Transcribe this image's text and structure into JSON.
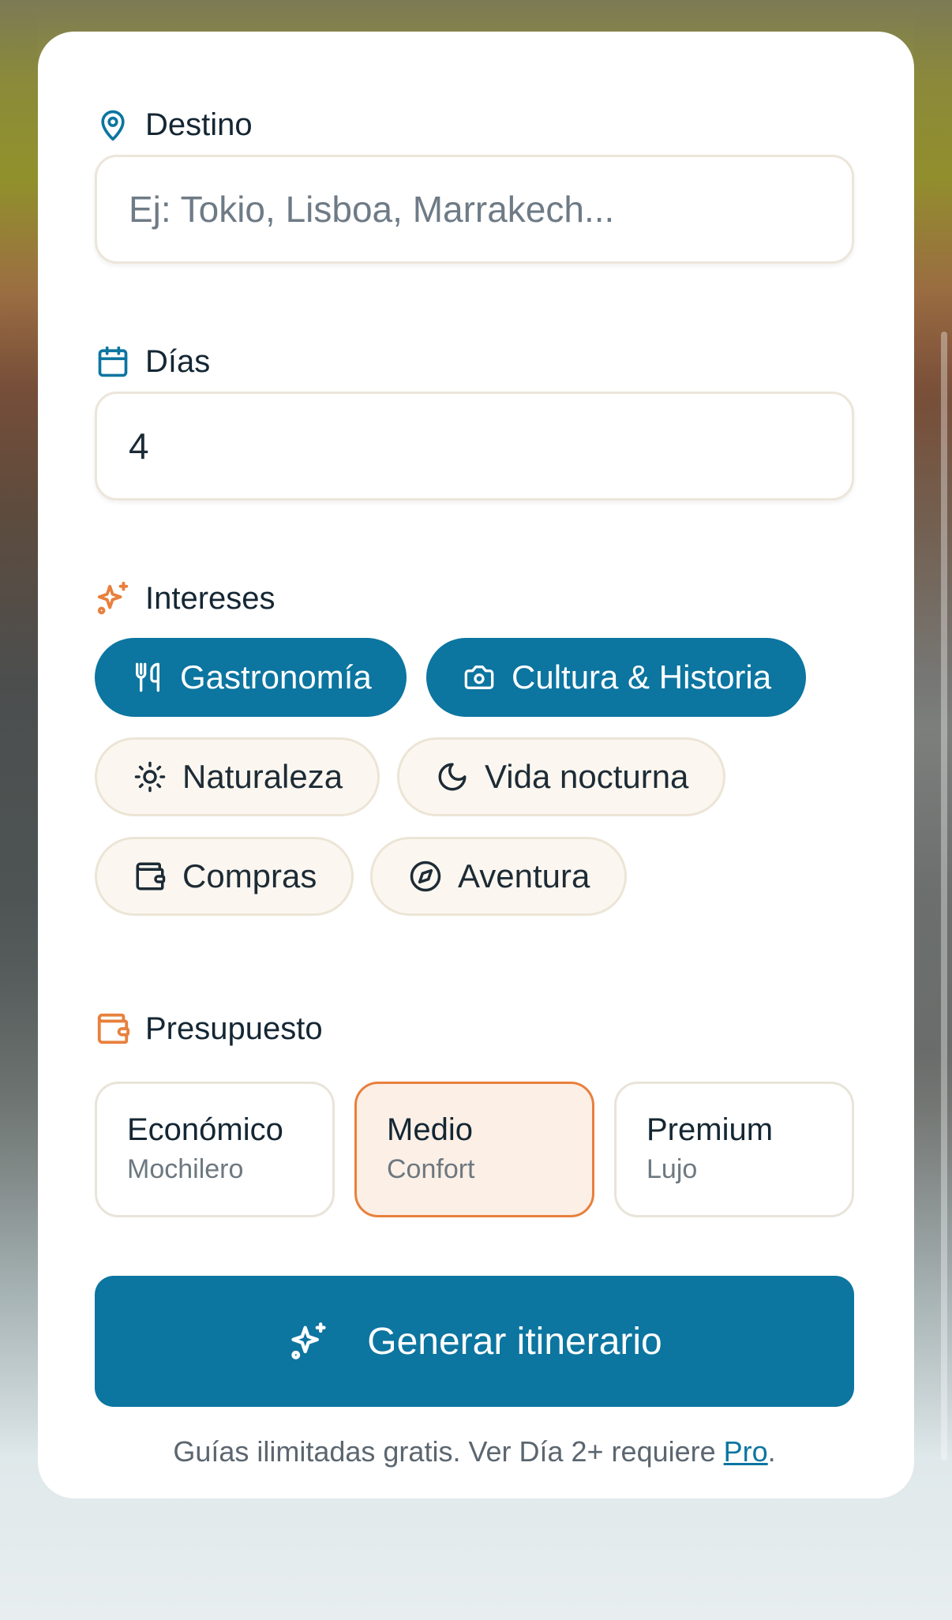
{
  "form": {
    "destino": {
      "label": "Destino",
      "placeholder": "Ej: Tokio, Lisboa, Marrakech...",
      "value": ""
    },
    "dias": {
      "label": "Días",
      "value": "4"
    },
    "intereses": {
      "label": "Intereses",
      "chips": [
        {
          "label": "Gastronomía",
          "icon": "utensils-icon",
          "selected": true
        },
        {
          "label": "Cultura & Historia",
          "icon": "camera-icon",
          "selected": true
        },
        {
          "label": "Naturaleza",
          "icon": "sun-icon",
          "selected": false
        },
        {
          "label": "Vida nocturna",
          "icon": "moon-icon",
          "selected": false
        },
        {
          "label": "Compras",
          "icon": "wallet-icon",
          "selected": false
        },
        {
          "label": "Aventura",
          "icon": "compass-icon",
          "selected": false
        }
      ]
    },
    "presupuesto": {
      "label": "Presupuesto",
      "options": [
        {
          "title": "Económico",
          "subtitle": "Mochilero",
          "selected": false
        },
        {
          "title": "Medio",
          "subtitle": "Confort",
          "selected": true
        },
        {
          "title": "Premium",
          "subtitle": "Lujo",
          "selected": false
        }
      ]
    },
    "generate_label": "Generar itinerario",
    "footnote": {
      "text": "Guías ilimitadas gratis. Ver Día 2+ requiere ",
      "link": "Pro",
      "suffix": "."
    }
  },
  "colors": {
    "primary": "#0c75a0",
    "accent": "#e8803d",
    "text": "#142633",
    "chip_inactive_bg": "#fbf7f0",
    "budget_selected_bg": "#fcefe5"
  }
}
